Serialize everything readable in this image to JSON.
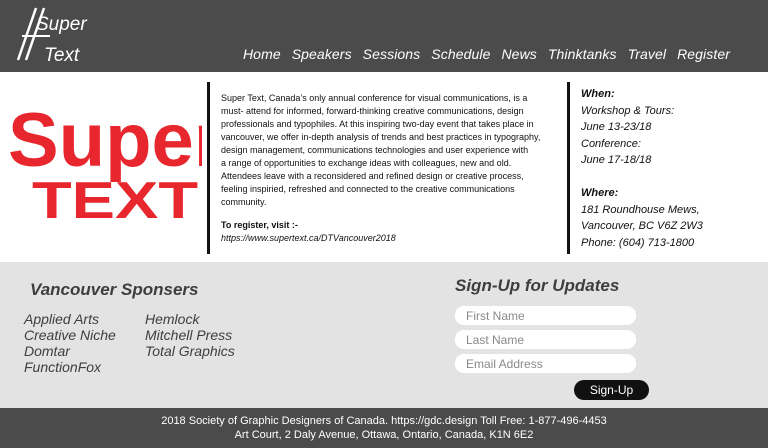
{
  "header": {
    "logo": {
      "line1": "Super",
      "line2": "Text"
    },
    "nav": [
      "Home",
      "Speakers",
      "Sessions",
      "Schedule",
      "News",
      "Thinktanks",
      "Travel",
      "Register"
    ]
  },
  "hero": {
    "big_logo": {
      "line1": "Super",
      "line2": "TEXT",
      "color": "#e8262d"
    },
    "about": {
      "lines": [
        "Super Text, Canada’s only annual conference for visual communications, is a",
        "must- attend for informed, forward-thinking creative communications, design",
        "professionals and typophiles. At this inspiring two-day event that takes place in",
        "vancouver, we offer in-depth analysis of trends and best practices in typography,",
        "design management, communications technologies and user experience with",
        "a range of opportunities to exchange ideas with colleagues, new and old.",
        "Attendees leave with a reconsidered and refined design or creative process,",
        "feeling inspiried, refreshed and connected to the creative communications",
        "community."
      ],
      "register_label": "To register, visit :-",
      "register_url": "https://www.supertext.ca/DTVancouver2018"
    },
    "when": {
      "heading": "When:",
      "lines": [
        "Workshop & Tours:",
        "June 13-23/18",
        "Conference:",
        "June 17-18/18"
      ]
    },
    "where": {
      "heading": "Where:",
      "lines": [
        "181 Roundhouse Mews,",
        "Vancouver, BC V6Z 2W3",
        "Phone: (604) 713-1800"
      ]
    }
  },
  "sponsors": {
    "title": "Vancouver Sponsers",
    "col1": [
      "Applied Arts",
      "Creative Niche",
      "Domtar",
      "FunctionFox"
    ],
    "col2": [
      "Hemlock",
      "Mitchell Press",
      "Total Graphics"
    ]
  },
  "signup": {
    "title": "Sign-Up for Updates",
    "first_name_placeholder": "First Name",
    "last_name_placeholder": "Last Name",
    "email_placeholder": "Email Address",
    "button": "Sign-Up"
  },
  "footer": {
    "line1": "2018 Society of Graphic Designers of Canada.  https://gdc.design  Toll Free: 1-877-496-4453",
    "line2": "Art Court, 2 Daly Avenue, Ottawa, Ontario, Canada, K1N 6E2"
  }
}
